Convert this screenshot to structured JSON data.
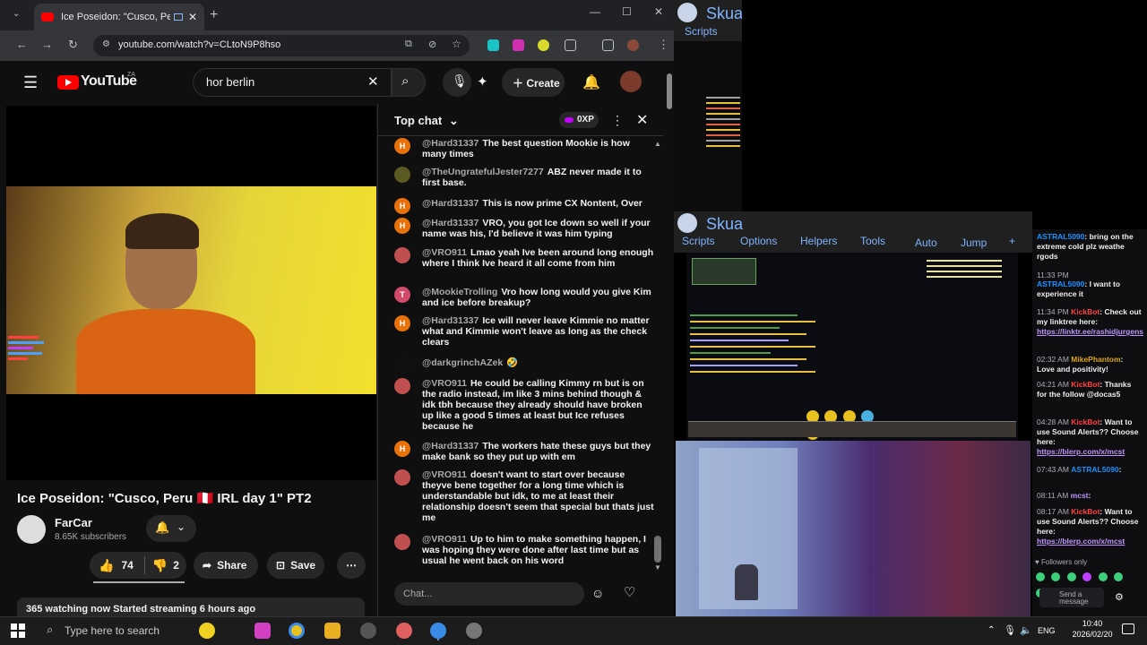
{
  "browser": {
    "tab_title": "Ice Poseidon: \"Cusco, Peru",
    "url": "youtube.com/watch?v=CLtoN9P8hso",
    "controls": {
      "minimize": "—",
      "maximize": "☐",
      "close": "✕"
    }
  },
  "youtube": {
    "logo_text": "YouTube",
    "logo_region": "ZA",
    "search_value": "hor berlin",
    "create_label": "Create",
    "video_title": "Ice Poseidon: \"Cusco, Peru 🇵🇪 IRL day 1\" PT2",
    "channel_name": "FarCar",
    "channel_subs": "8.65K subscribers",
    "likes": "74",
    "dislikes": "2",
    "share_label": "Share",
    "save_label": "Save",
    "watching": "365 watching now  Started streaming 6 hours ago"
  },
  "chat": {
    "title": "Top chat",
    "points": "0XP",
    "input_placeholder": "Chat...",
    "messages": [
      {
        "initial": "H",
        "color": "#e8710a",
        "author": "@Hard31337",
        "text": "The best question Mookie is how many times"
      },
      {
        "initial": "",
        "color": "#5a5a22",
        "author": "@TheUngratefulJester7277",
        "text": "ABZ never made it to first base."
      },
      {
        "initial": "H",
        "color": "#e8710a",
        "author": "@Hard31337",
        "text": "This is now prime CX Nontent, Over"
      },
      {
        "initial": "H",
        "color": "#e8710a",
        "author": "@Hard31337",
        "text": "VRO, you got Ice down so well if your name was his, I'd believe it was him typing"
      },
      {
        "initial": "",
        "color": "#c05050",
        "author": "@VRO911",
        "text": "Lmao yeah Ive been around long enough where I think Ive heard it all come from him"
      },
      {
        "initial": "T",
        "color": "#d04a6a",
        "author": "@MookieTrolling",
        "text": "Vro how long would you give Kim and ice before breakup?"
      },
      {
        "initial": "H",
        "color": "#e8710a",
        "author": "@Hard31337",
        "text": "Ice will never leave Kimmie no matter what and Kimmie won't leave as long as the check clears"
      },
      {
        "initial": "",
        "color": "#111111",
        "author": "@darkgrinchAZek",
        "text": "🤣"
      },
      {
        "initial": "",
        "color": "#c05050",
        "author": "@VRO911",
        "text": "He could be calling Kimmy rn but is on the radio instead, im like 3 mins behind though & idk tbh because they already should have broken up like a good 5 times at least but Ice refuses because he"
      },
      {
        "initial": "H",
        "color": "#e8710a",
        "author": "@Hard31337",
        "text": "The workers hate these guys but they make bank so they put up with em"
      },
      {
        "initial": "",
        "color": "#c05050",
        "author": "@VRO911",
        "text": "doesn't want to start over because theyve bene together for a long time which is understandable but idk, to me at least their relationship doesn't seem that special but thats just me"
      },
      {
        "initial": "",
        "color": "#c05050",
        "author": "@VRO911",
        "text": "Up to him to make something happen, I was hoping they were done after last time but as usual he went back on his word"
      }
    ]
  },
  "skua": {
    "title": "Skua",
    "scripts_label": "Scripts",
    "nav": [
      "Scripts",
      "Options",
      "Helpers",
      "Tools",
      "Auto",
      "Jump",
      "+"
    ]
  },
  "twitch": {
    "messages": [
      {
        "time": "",
        "name": "ASTRAL5090",
        "name_color": "#1e90ff",
        "text": ": bring on the extreme cold plz weathe rgods",
        "link": ""
      },
      {
        "time": "11:33 PM",
        "name": "",
        "name_color": "#1e90ff",
        "text": "",
        "link": ""
      },
      {
        "time": "",
        "name": "ASTRAL5090",
        "name_color": "#1e90ff",
        "text": ": I want to experience it",
        "link": ""
      },
      {
        "time": "11:34 PM",
        "name": "KickBot",
        "name_color": "#ff4040",
        "text": ": Check out my linktree here:",
        "link": "https://linktr.ee/rashidjurgens"
      },
      {
        "time": "02:32 AM",
        "name": "MikePhantom",
        "name_color": "#daa520",
        "text": ": Love and positivity!",
        "link": ""
      },
      {
        "time": "04:21 AM",
        "name": "KickBot",
        "name_color": "#ff4040",
        "text": ": Thanks for the follow @docas5",
        "link": ""
      },
      {
        "time": "04:28 AM",
        "name": "KickBot",
        "name_color": "#ff4040",
        "text": ": Want to use Sound Alerts?? Choose here:",
        "link": "https://blerp.com/x/mcst"
      },
      {
        "time": "07:43 AM",
        "name": "ASTRAL5090",
        "name_color": "#1e90ff",
        "text": ":",
        "link": ""
      },
      {
        "time": "08:11 AM",
        "name": "mcst",
        "name_color": "#bf94ff",
        "text": ":",
        "link": ""
      },
      {
        "time": "08:17 AM",
        "name": "KickBot",
        "name_color": "#ff4040",
        "text": ": Want to use Sound Alerts?? Choose here:",
        "link": "https://blerp.com/x/mcst"
      }
    ],
    "followers_only": "Followers only",
    "send_placeholder": "Send a message"
  },
  "taskbar": {
    "search_placeholder": "Type here to search",
    "lang": "ENG",
    "time": "10:40",
    "date": "2026/02/20"
  }
}
